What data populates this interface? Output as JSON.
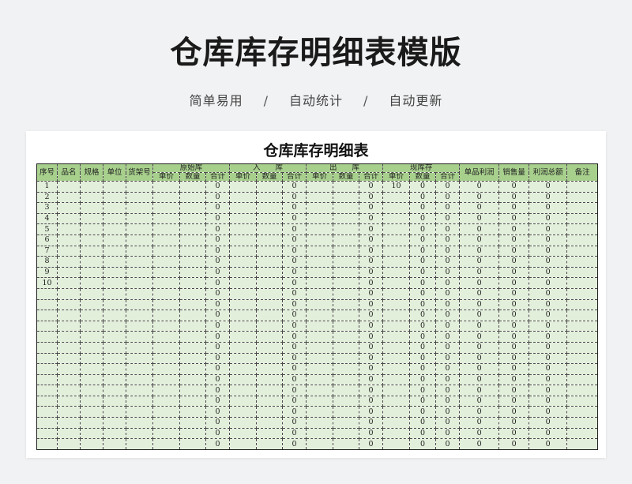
{
  "page": {
    "title": "仓库库存明细表模版",
    "subtitle_items": [
      "简单易用",
      "自动统计",
      "自动更新"
    ],
    "separator": "/"
  },
  "sheet": {
    "title": "仓库库存明细表",
    "headers": {
      "seq": "序号",
      "name": "品名",
      "spec": "规格",
      "unit": "单位",
      "shelf": "货架号",
      "group_original": "原始库",
      "group_in": "入　　库",
      "group_out": "出　　库",
      "group_current": "现库存",
      "unit_price": "单价",
      "quantity": "数量",
      "total": "合计",
      "unit_profit": "单品利润",
      "sales_volume": "销售量",
      "total_profit": "利润总额",
      "remarks": "备注"
    },
    "first_row_current_unit_price": "10",
    "rows": [
      {
        "seq": "1",
        "orig_total": "0",
        "in_total": "0",
        "out_total": "0",
        "cur_price": "10",
        "cur_qty": "0",
        "cur_total": "0",
        "unit_profit": "0",
        "sales": "0",
        "profit_total": "0"
      },
      {
        "seq": "2",
        "orig_total": "0",
        "in_total": "0",
        "out_total": "0",
        "cur_price": "",
        "cur_qty": "0",
        "cur_total": "0",
        "unit_profit": "0",
        "sales": "0",
        "profit_total": "0"
      },
      {
        "seq": "3",
        "orig_total": "0",
        "in_total": "0",
        "out_total": "0",
        "cur_price": "",
        "cur_qty": "0",
        "cur_total": "0",
        "unit_profit": "0",
        "sales": "0",
        "profit_total": "0"
      },
      {
        "seq": "4",
        "orig_total": "0",
        "in_total": "0",
        "out_total": "0",
        "cur_price": "",
        "cur_qty": "0",
        "cur_total": "0",
        "unit_profit": "0",
        "sales": "0",
        "profit_total": "0"
      },
      {
        "seq": "5",
        "orig_total": "0",
        "in_total": "0",
        "out_total": "0",
        "cur_price": "",
        "cur_qty": "0",
        "cur_total": "0",
        "unit_profit": "0",
        "sales": "0",
        "profit_total": "0"
      },
      {
        "seq": "6",
        "orig_total": "0",
        "in_total": "0",
        "out_total": "0",
        "cur_price": "",
        "cur_qty": "0",
        "cur_total": "0",
        "unit_profit": "0",
        "sales": "0",
        "profit_total": "0"
      },
      {
        "seq": "7",
        "orig_total": "0",
        "in_total": "0",
        "out_total": "0",
        "cur_price": "",
        "cur_qty": "0",
        "cur_total": "0",
        "unit_profit": "0",
        "sales": "0",
        "profit_total": "0"
      },
      {
        "seq": "8",
        "orig_total": "0",
        "in_total": "0",
        "out_total": "0",
        "cur_price": "",
        "cur_qty": "0",
        "cur_total": "0",
        "unit_profit": "0",
        "sales": "0",
        "profit_total": "0"
      },
      {
        "seq": "9",
        "orig_total": "0",
        "in_total": "0",
        "out_total": "0",
        "cur_price": "",
        "cur_qty": "0",
        "cur_total": "0",
        "unit_profit": "0",
        "sales": "0",
        "profit_total": "0"
      },
      {
        "seq": "10",
        "orig_total": "0",
        "in_total": "0",
        "out_total": "0",
        "cur_price": "",
        "cur_qty": "0",
        "cur_total": "0",
        "unit_profit": "0",
        "sales": "0",
        "profit_total": "0"
      },
      {
        "seq": "",
        "orig_total": "0",
        "in_total": "0",
        "out_total": "0",
        "cur_price": "",
        "cur_qty": "0",
        "cur_total": "0",
        "unit_profit": "0",
        "sales": "0",
        "profit_total": "0"
      },
      {
        "seq": "",
        "orig_total": "0",
        "in_total": "0",
        "out_total": "0",
        "cur_price": "",
        "cur_qty": "0",
        "cur_total": "0",
        "unit_profit": "0",
        "sales": "0",
        "profit_total": "0"
      },
      {
        "seq": "",
        "orig_total": "0",
        "in_total": "0",
        "out_total": "0",
        "cur_price": "",
        "cur_qty": "0",
        "cur_total": "0",
        "unit_profit": "0",
        "sales": "0",
        "profit_total": "0"
      },
      {
        "seq": "",
        "orig_total": "0",
        "in_total": "0",
        "out_total": "0",
        "cur_price": "",
        "cur_qty": "0",
        "cur_total": "0",
        "unit_profit": "0",
        "sales": "0",
        "profit_total": "0"
      },
      {
        "seq": "",
        "orig_total": "0",
        "in_total": "0",
        "out_total": "0",
        "cur_price": "",
        "cur_qty": "0",
        "cur_total": "0",
        "unit_profit": "0",
        "sales": "0",
        "profit_total": "0"
      },
      {
        "seq": "",
        "orig_total": "0",
        "in_total": "0",
        "out_total": "0",
        "cur_price": "",
        "cur_qty": "0",
        "cur_total": "0",
        "unit_profit": "0",
        "sales": "0",
        "profit_total": "0"
      },
      {
        "seq": "",
        "orig_total": "0",
        "in_total": "0",
        "out_total": "0",
        "cur_price": "",
        "cur_qty": "0",
        "cur_total": "0",
        "unit_profit": "0",
        "sales": "0",
        "profit_total": "0"
      },
      {
        "seq": "",
        "orig_total": "0",
        "in_total": "0",
        "out_total": "0",
        "cur_price": "",
        "cur_qty": "0",
        "cur_total": "0",
        "unit_profit": "0",
        "sales": "0",
        "profit_total": "0"
      },
      {
        "seq": "",
        "orig_total": "0",
        "in_total": "0",
        "out_total": "0",
        "cur_price": "",
        "cur_qty": "0",
        "cur_total": "0",
        "unit_profit": "0",
        "sales": "0",
        "profit_total": "0"
      },
      {
        "seq": "",
        "orig_total": "0",
        "in_total": "0",
        "out_total": "0",
        "cur_price": "",
        "cur_qty": "0",
        "cur_total": "0",
        "unit_profit": "0",
        "sales": "0",
        "profit_total": "0"
      },
      {
        "seq": "",
        "orig_total": "0",
        "in_total": "0",
        "out_total": "0",
        "cur_price": "",
        "cur_qty": "0",
        "cur_total": "0",
        "unit_profit": "0",
        "sales": "0",
        "profit_total": "0"
      },
      {
        "seq": "",
        "orig_total": "0",
        "in_total": "0",
        "out_total": "0",
        "cur_price": "",
        "cur_qty": "0",
        "cur_total": "0",
        "unit_profit": "0",
        "sales": "0",
        "profit_total": "0"
      },
      {
        "seq": "",
        "orig_total": "0",
        "in_total": "0",
        "out_total": "0",
        "cur_price": "",
        "cur_qty": "0",
        "cur_total": "0",
        "unit_profit": "0",
        "sales": "0",
        "profit_total": "0"
      },
      {
        "seq": "",
        "orig_total": "0",
        "in_total": "0",
        "out_total": "0",
        "cur_price": "",
        "cur_qty": "0",
        "cur_total": "0",
        "unit_profit": "0",
        "sales": "0",
        "profit_total": "0"
      },
      {
        "seq": "",
        "orig_total": "0",
        "in_total": "0",
        "out_total": "0",
        "cur_price": "",
        "cur_qty": "0",
        "cur_total": "0",
        "unit_profit": "0",
        "sales": "0",
        "profit_total": "0"
      }
    ]
  }
}
